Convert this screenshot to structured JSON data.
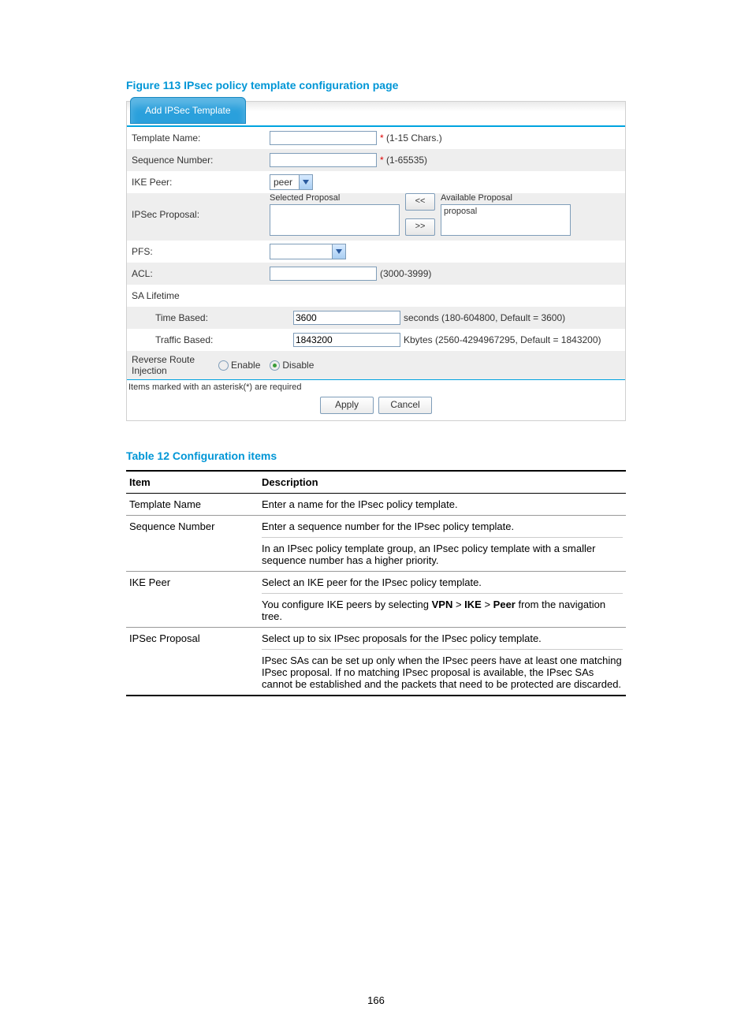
{
  "figure_title": "Figure 113 IPsec policy template configuration page",
  "tab_label": "Add IPSec Template",
  "labels": {
    "template_name": "Template Name:",
    "sequence_number": "Sequence Number:",
    "ike_peer": "IKE Peer:",
    "ipsec_proposal": "IPSec Proposal:",
    "selected_proposal": "Selected Proposal",
    "available_proposal": "Available Proposal",
    "available_item": "proposal",
    "pfs": "PFS:",
    "acl": "ACL:",
    "sa_lifetime": "SA Lifetime",
    "time_based": "Time Based:",
    "traffic_based": "Traffic Based:",
    "rri": "Reverse Route Injection",
    "rri_enable": "Enable",
    "rri_disable": "Disable"
  },
  "hints": {
    "template_name": "(1-15 Chars.)",
    "sequence_number": "(1-65535)",
    "acl": "(3000-3999)",
    "time_based": "seconds (180-604800, Default = 3600)",
    "traffic_based": "Kbytes (2560-4294967295, Default = 1843200)"
  },
  "values": {
    "template_name": "",
    "sequence_number": "",
    "ike_peer": "peer",
    "pfs": "",
    "acl": "",
    "time_based": "3600",
    "traffic_based": "1843200"
  },
  "move_buttons": {
    "left": "<<",
    "right": ">>"
  },
  "asterisk_note": "Items marked with an asterisk(*) are required",
  "buttons": {
    "apply": "Apply",
    "cancel": "Cancel"
  },
  "required_mark": "*",
  "table_title": "Table 12 Configuration items",
  "table": {
    "head_item": "Item",
    "head_desc": "Description",
    "rows": [
      {
        "item": "Template Name",
        "desc_a": "Enter a name for the IPsec policy template."
      },
      {
        "item": "Sequence Number",
        "desc_a": "Enter a sequence number for the IPsec policy template.",
        "desc_b": "In an IPsec policy template group, an IPsec policy template with a smaller sequence number has a higher priority."
      },
      {
        "item": "IKE Peer",
        "desc_a": "Select an IKE peer for the IPsec policy template.",
        "desc_b_pre": "You configure IKE peers by selecting ",
        "desc_b_b1": "VPN",
        "desc_b_sep": " > ",
        "desc_b_b2": "IKE",
        "desc_b_b3": "Peer",
        "desc_b_post": " from the navigation tree."
      },
      {
        "item": "IPSec Proposal",
        "desc_a": "Select up to six IPsec proposals for the IPsec policy template.",
        "desc_b": "IPsec SAs can be set up only when the IPsec peers have at least one matching IPsec proposal. If no matching IPsec proposal is available, the IPsec SAs cannot be established and the packets that need to be protected are discarded."
      }
    ]
  },
  "page_number": "166"
}
